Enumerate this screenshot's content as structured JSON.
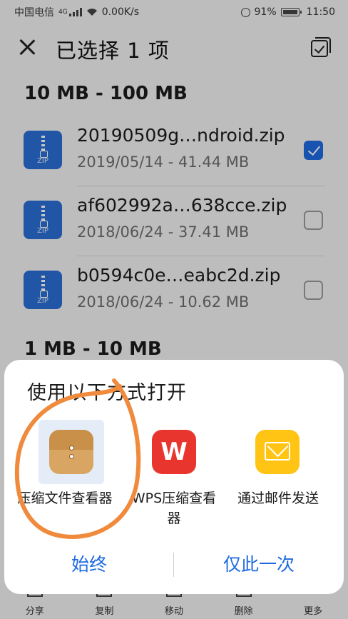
{
  "status_bar": {
    "carrier": "中国电信",
    "network": "4G",
    "speed": "0.00K/s",
    "battery": "91%",
    "time": "11:50"
  },
  "header": {
    "title": "已选择 1 项"
  },
  "sections": [
    {
      "title": "10 MB - 100 MB",
      "files": [
        {
          "name": "20190509g…ndroid.zip",
          "meta": "2019/05/14 - 41.44 MB",
          "checked": true
        },
        {
          "name": "af602992a…638cce.zip",
          "meta": "2018/06/24 - 37.41 MB",
          "checked": false
        },
        {
          "name": "b0594c0e…eabc2d.zip",
          "meta": "2018/06/24 - 10.62 MB",
          "checked": false
        }
      ]
    },
    {
      "title": "1 MB - 10 MB",
      "files": []
    }
  ],
  "zip_icon_text": "ZIP",
  "toolbar": {
    "share": "分享",
    "copy": "复制",
    "move": "移动",
    "delete": "删除",
    "more": "更多"
  },
  "open_with_sheet": {
    "title": "使用以下方式打开",
    "apps": [
      {
        "label": "压缩文件查看器",
        "icon": "archive-icon",
        "color": "#d9a563"
      },
      {
        "label": "WPS压缩查看器",
        "icon": "wps-icon",
        "color": "#e8362f",
        "glyph": "W"
      },
      {
        "label": "通过邮件发送",
        "icon": "mail-icon",
        "color": "#ffc414"
      }
    ],
    "always_button": "始终",
    "once_button": "仅此一次"
  },
  "colors": {
    "accent": "#1f6be0",
    "annotation": "#f08a3c"
  }
}
